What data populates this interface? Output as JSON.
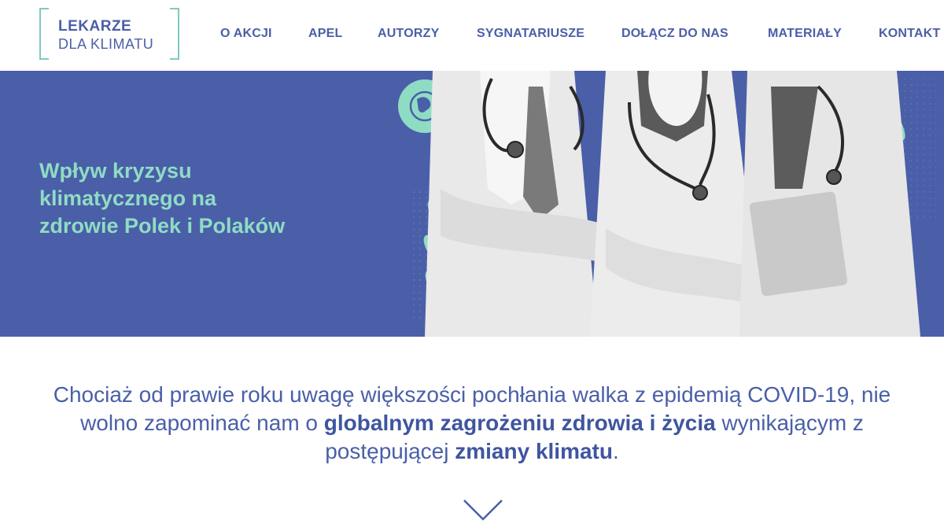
{
  "header": {
    "logo": {
      "line1": "LEKARZE",
      "line2": "DLA KLIMATU"
    },
    "nav": [
      {
        "label": "O AKCJI"
      },
      {
        "label": "APEL"
      },
      {
        "label": "AUTORZY"
      },
      {
        "label": "SYGNATARIUSZE"
      },
      {
        "label": "DOŁĄCZ DO NAS"
      },
      {
        "label": "MATERIAŁY"
      },
      {
        "label": "KONTAKT"
      }
    ]
  },
  "hero": {
    "title": "Wpływ kryzysu klimatycznego na zdrowie Polek i Polaków"
  },
  "intro": {
    "part1": "Chociaż od prawie roku uwagę większości pochłania walka z epidemią COVID-19, nie wolno zapominać nam o ",
    "bold1": "globalnym zagrożeniu zdrowia i życia",
    "part2": " wynikającym z postępującej ",
    "bold2": "zmiany klimatu",
    "part3": "."
  },
  "colors": {
    "brand_blue": "#4a5fa8",
    "accent_mint": "#8fdcc4"
  },
  "icons": {
    "scroll": "chevron-down-icon",
    "globe": "globe-icon",
    "document": "document-icon"
  }
}
